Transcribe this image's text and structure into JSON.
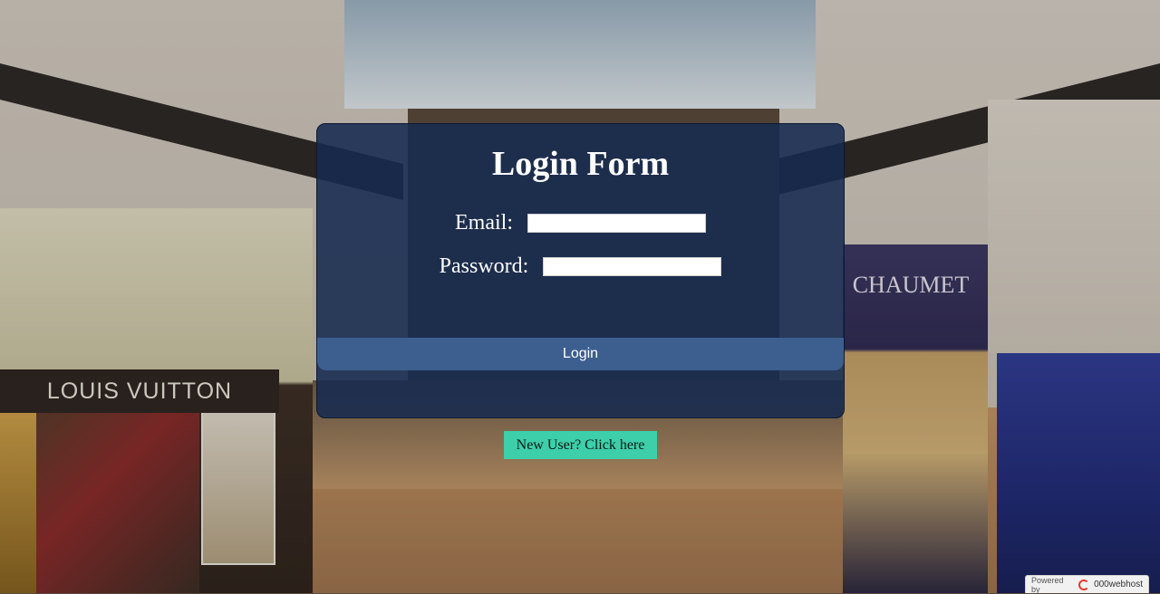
{
  "login_form": {
    "title": "Login Form",
    "email_label": "Email:",
    "email_value": "",
    "password_label": "Password:",
    "password_value": "",
    "login_button": "Login"
  },
  "new_user_link": "New User? Click here",
  "badge": {
    "powered_by": "Powered by",
    "brand": "000webhost"
  },
  "background_signage": {
    "store_left": "LOUIS VUITTON",
    "store_right": "CHAUMET"
  },
  "colors": {
    "panel": "#172a50",
    "login_button": "#3d5f8f",
    "new_user_button": "#3ccfaa"
  }
}
